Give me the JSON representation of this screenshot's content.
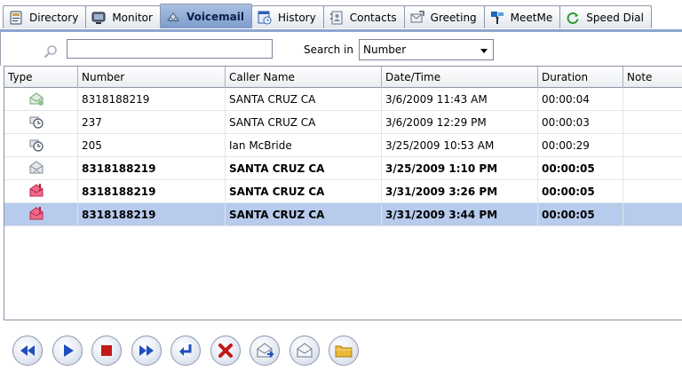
{
  "tabs": [
    {
      "label": "Directory",
      "icon": "directory-icon",
      "active": false
    },
    {
      "label": "Monitor",
      "icon": "monitor-icon",
      "active": false
    },
    {
      "label": "Voicemail",
      "icon": "voicemail-icon",
      "active": true
    },
    {
      "label": "History",
      "icon": "history-icon",
      "active": false
    },
    {
      "label": "Contacts",
      "icon": "contacts-icon",
      "active": false
    },
    {
      "label": "Greeting",
      "icon": "greeting-icon",
      "active": false
    },
    {
      "label": "MeetMe",
      "icon": "meetme-icon",
      "active": false
    },
    {
      "label": "Speed Dial",
      "icon": "speed-dial-icon",
      "active": false
    }
  ],
  "search": {
    "value": "",
    "search_in_label": "Search in",
    "search_in_value": "Number"
  },
  "table": {
    "columns": [
      "Type",
      "Number",
      "Caller Name",
      "Date/Time",
      "Duration",
      "Note"
    ],
    "rows": [
      {
        "type": "read-voicemail-icon",
        "number": "8318188219",
        "caller": "SANTA CRUZ  CA",
        "datetime": "3/6/2009 11:43 AM",
        "duration": "00:00:04",
        "note": "",
        "bold": false,
        "selected": false
      },
      {
        "type": "played-voicemail-icon",
        "number": "237",
        "caller": "SANTA CRUZ  CA",
        "datetime": "3/6/2009 12:29 PM",
        "duration": "00:00:03",
        "note": "",
        "bold": false,
        "selected": false
      },
      {
        "type": "played-voicemail-icon",
        "number": "205",
        "caller": "Ian McBride",
        "datetime": "3/25/2009 10:53 AM",
        "duration": "00:00:29",
        "note": "",
        "bold": false,
        "selected": false
      },
      {
        "type": "new-voicemail-icon",
        "number": "8318188219",
        "caller": "SANTA CRUZ  CA",
        "datetime": "3/25/2009 1:10 PM",
        "duration": "00:00:05",
        "note": "",
        "bold": true,
        "selected": false
      },
      {
        "type": "urgent-voicemail-icon",
        "number": "8318188219",
        "caller": "SANTA CRUZ  CA",
        "datetime": "3/31/2009 3:26 PM",
        "duration": "00:00:05",
        "note": "",
        "bold": true,
        "selected": false
      },
      {
        "type": "urgent-voicemail-icon",
        "number": "8318188219",
        "caller": "SANTA CRUZ  CA",
        "datetime": "3/31/2009 3:44 PM",
        "duration": "00:00:05",
        "note": "",
        "bold": true,
        "selected": true
      }
    ]
  },
  "toolbar": [
    {
      "name": "rewind-button",
      "icon": "rewind-icon",
      "color": "#1f4fbf"
    },
    {
      "name": "play-button",
      "icon": "play-icon",
      "color": "#1f4fbf"
    },
    {
      "name": "stop-button",
      "icon": "stop-icon",
      "color": "#c21818"
    },
    {
      "name": "fast-forward-button",
      "icon": "fast-forward-icon",
      "color": "#1f4fbf"
    },
    {
      "name": "call-back-button",
      "icon": "return-icon",
      "color": "#1f4fbf"
    },
    {
      "name": "delete-button",
      "icon": "delete-icon",
      "color": "#c21818"
    },
    {
      "name": "forward-message-button",
      "icon": "forward-envelope-icon",
      "color": "#6d7687"
    },
    {
      "name": "mark-read-button",
      "icon": "envelope-icon",
      "color": "#6d7687"
    },
    {
      "name": "save-folder-button",
      "icon": "folder-icon",
      "color": "#e9b93a"
    }
  ],
  "colors": {
    "active_tab": "#8ca6cf",
    "selected_row": "#b7cbed"
  }
}
